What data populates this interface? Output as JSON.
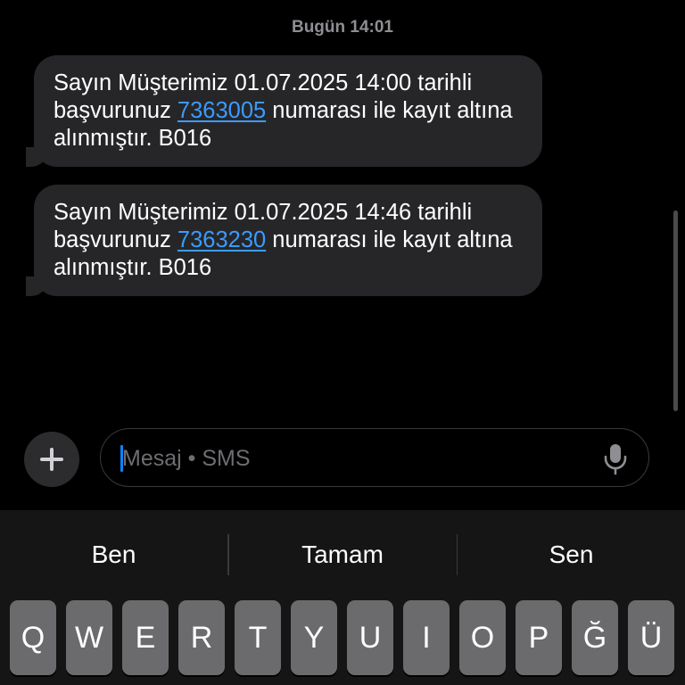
{
  "header": {
    "timestamp": "Bugün 14:01"
  },
  "messages": [
    {
      "before_link": "Sayın Müşterimiz 01.07.2025 14:00 tarihli başvurunuz ",
      "link": "7363005",
      "after_link": " numarası ile kayıt altına alınmıştır. B016"
    },
    {
      "before_link": "Sayın Müşterimiz 01.07.2025 14:46 tarihli başvurunuz ",
      "link": "7363230",
      "after_link": " numarası ile kayıt altına alınmıştır. B016"
    }
  ],
  "composer": {
    "placeholder": "Mesaj • SMS",
    "value": ""
  },
  "icons": {
    "plus": "plus-icon",
    "mic": "microphone-icon"
  },
  "keyboard": {
    "suggestions": [
      "Ben",
      "Tamam",
      "Sen"
    ],
    "row1": [
      "Q",
      "W",
      "E",
      "R",
      "T",
      "Y",
      "U",
      "I",
      "O",
      "P",
      "Ğ",
      "Ü"
    ]
  },
  "colors": {
    "bubble": "#262628",
    "link": "#3b9bff",
    "key": "#6b6b6d"
  }
}
